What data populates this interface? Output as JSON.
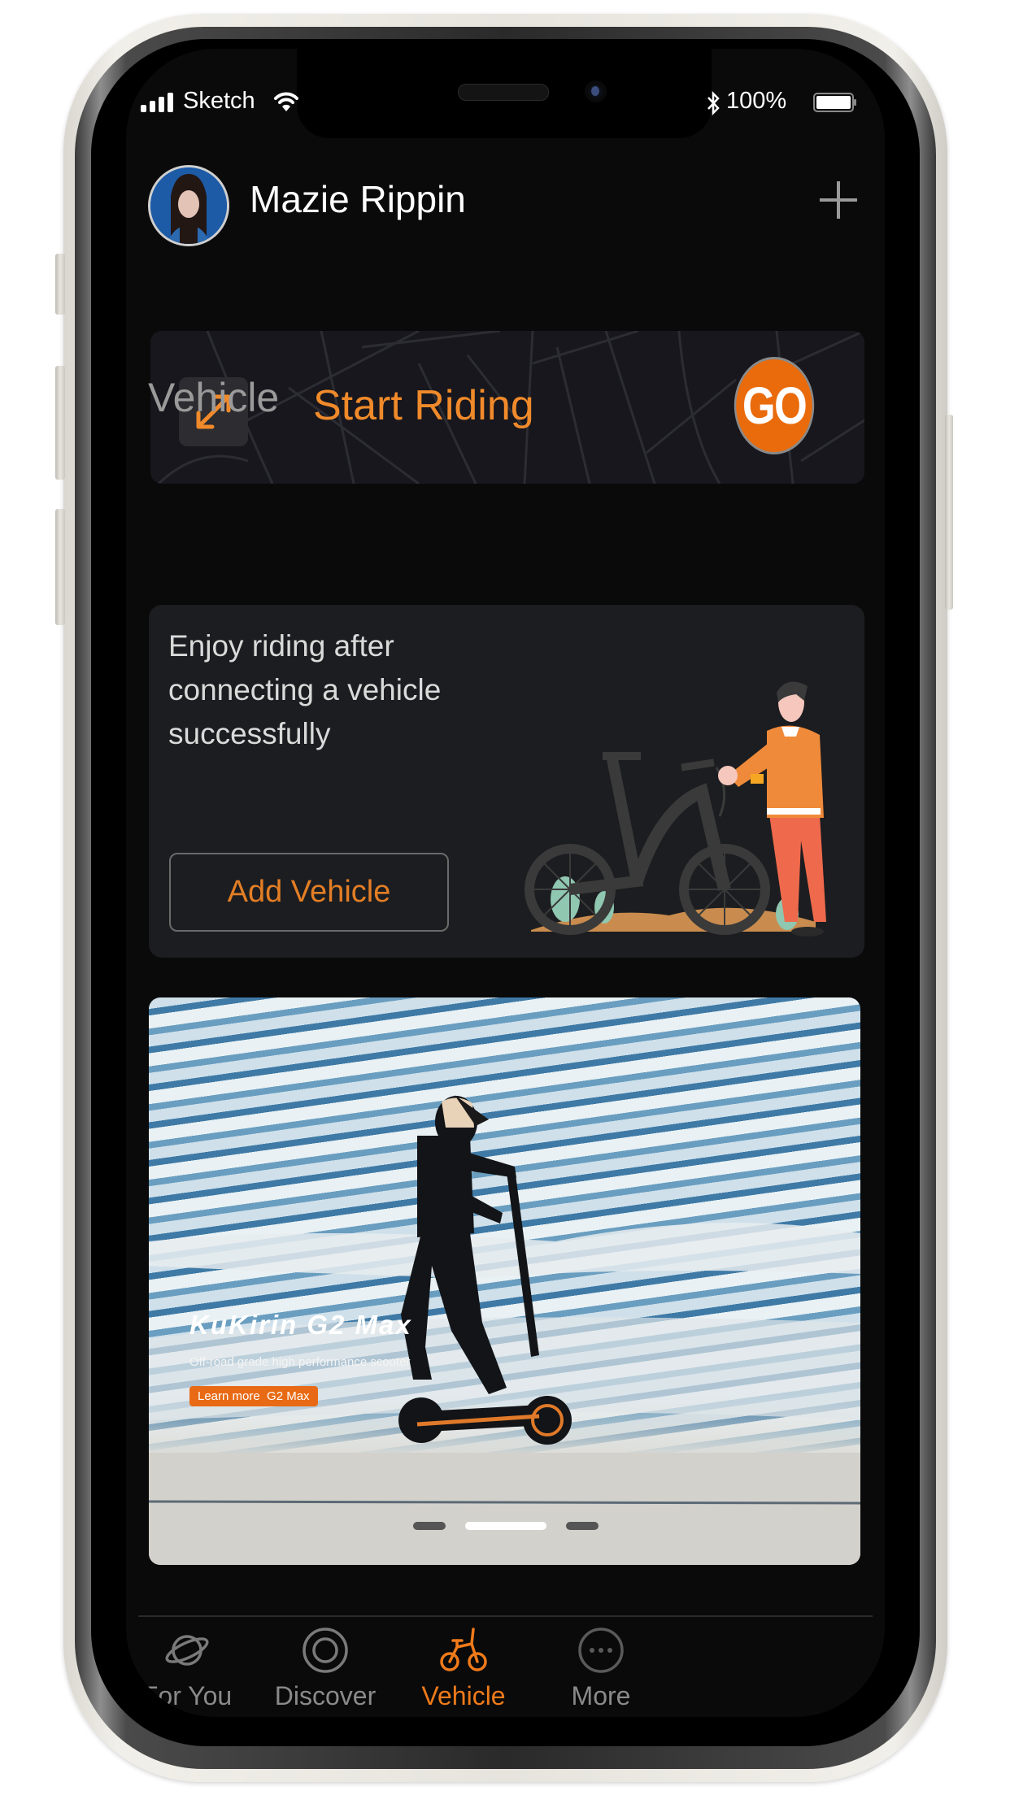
{
  "status_bar": {
    "carrier": "Sketch",
    "battery_percent": "100%",
    "signal_icon": "signal-bars-icon",
    "wifi_icon": "wifi-icon",
    "bluetooth_icon": "bluetooth-icon",
    "battery_icon": "battery-icon"
  },
  "header": {
    "user_name": "Mazie Rippin",
    "add_icon": "plus-icon"
  },
  "start_riding": {
    "label": "Start Riding",
    "go_label": "GO",
    "expand_icon": "expand-arrows-icon"
  },
  "vehicle": {
    "section_title": "Vehicle",
    "description": "Enjoy riding after connecting a vehicle successfully",
    "add_button": "Add Vehicle"
  },
  "banner": {
    "title": "KuKirin G2 Max",
    "subtitle": "Off-road grade high performance scooter",
    "cta": "Learn more  G2 Max",
    "slide_count": 3,
    "active_slide": 2
  },
  "tab_bar": {
    "tabs": [
      {
        "label": "For You",
        "icon": "planet-icon",
        "active": false
      },
      {
        "label": "Discover",
        "icon": "discover-circle-icon",
        "active": false
      },
      {
        "label": "Vehicle",
        "icon": "bicycle-icon",
        "active": true
      },
      {
        "label": "More",
        "icon": "more-dots-icon",
        "active": false
      }
    ]
  },
  "colors": {
    "accent": "#ef7a1a",
    "go_button": "#e96b0c",
    "background": "#0a0a0a",
    "card": "#1c1d20",
    "inactive_tab": "#8a8a8a"
  }
}
